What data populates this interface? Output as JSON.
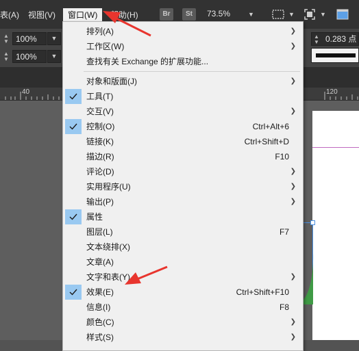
{
  "menubar": {
    "items": [
      {
        "id": "table",
        "label": "表(A)"
      },
      {
        "id": "view",
        "label": "视图(V)"
      },
      {
        "id": "window",
        "label": "窗口(W)"
      },
      {
        "id": "help",
        "label": "帮助(H)"
      }
    ],
    "bridge_label": "Br",
    "stock_label": "St",
    "zoom": "73.5%"
  },
  "control_panel": {
    "scale_x": "100%",
    "scale_y": "100%",
    "stroke_weight": "0.283 点"
  },
  "ruler": {
    "label_left": "40",
    "label_right": "120"
  },
  "window_menu": {
    "items": [
      {
        "label": "排列(A)",
        "shortcut": "",
        "submenu": true,
        "checked": false
      },
      {
        "label": "工作区(W)",
        "shortcut": "",
        "submenu": true,
        "checked": false
      },
      {
        "label": "查找有关 Exchange 的扩展功能...",
        "shortcut": "",
        "submenu": false,
        "checked": false
      },
      {
        "label": "对象和版面(J)",
        "shortcut": "",
        "submenu": true,
        "checked": false
      },
      {
        "label": "工具(T)",
        "shortcut": "",
        "submenu": false,
        "checked": true
      },
      {
        "label": "交互(V)",
        "shortcut": "",
        "submenu": true,
        "checked": false
      },
      {
        "label": "控制(O)",
        "shortcut": "Ctrl+Alt+6",
        "submenu": false,
        "checked": true
      },
      {
        "label": "链接(K)",
        "shortcut": "Ctrl+Shift+D",
        "submenu": false,
        "checked": false
      },
      {
        "label": "描边(R)",
        "shortcut": "F10",
        "submenu": false,
        "checked": false
      },
      {
        "label": "评论(D)",
        "shortcut": "",
        "submenu": true,
        "checked": false
      },
      {
        "label": "实用程序(U)",
        "shortcut": "",
        "submenu": true,
        "checked": false
      },
      {
        "label": "输出(P)",
        "shortcut": "",
        "submenu": true,
        "checked": false
      },
      {
        "label": "属性",
        "shortcut": "",
        "submenu": false,
        "checked": true
      },
      {
        "label": "图层(L)",
        "shortcut": "F7",
        "submenu": false,
        "checked": false
      },
      {
        "label": "文本绕排(X)",
        "shortcut": "",
        "submenu": false,
        "checked": false
      },
      {
        "label": "文章(A)",
        "shortcut": "",
        "submenu": false,
        "checked": false
      },
      {
        "label": "文字和表(Y)",
        "shortcut": "",
        "submenu": true,
        "checked": false
      },
      {
        "label": "效果(E)",
        "shortcut": "Ctrl+Shift+F10",
        "submenu": false,
        "checked": true
      },
      {
        "label": "信息(I)",
        "shortcut": "F8",
        "submenu": false,
        "checked": false
      },
      {
        "label": "颜色(C)",
        "shortcut": "",
        "submenu": true,
        "checked": false
      },
      {
        "label": "样式(S)",
        "shortcut": "",
        "submenu": true,
        "checked": false
      }
    ]
  },
  "colors": {
    "annotation_arrow": "#e8352e",
    "check_highlight": "#99c9f1",
    "menu_background": "#f0f0f0",
    "ui_dark": "#323232"
  }
}
